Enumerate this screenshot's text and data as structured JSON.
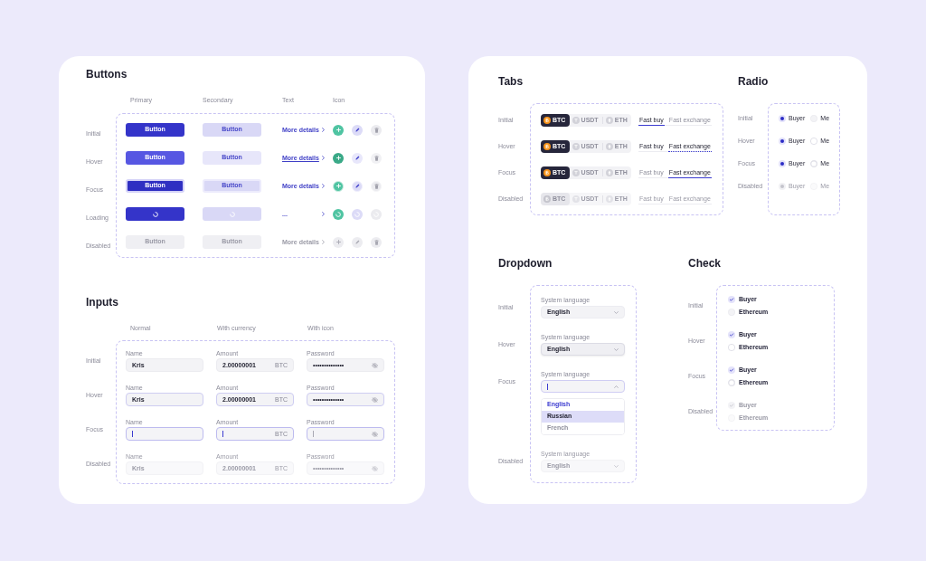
{
  "buttons": {
    "title": "Buttons",
    "columns": [
      "Primary",
      "Secondary",
      "Text",
      "Icon"
    ],
    "rows": [
      {
        "state": "Initial",
        "kind": "initial",
        "primary": "Button",
        "secondary": "Button",
        "link": "More details"
      },
      {
        "state": "Hover",
        "kind": "hover",
        "primary": "Button",
        "secondary": "Button",
        "link": "More details"
      },
      {
        "state": "Focus",
        "kind": "focus",
        "primary": "Button",
        "secondary": "Button",
        "link": "More details"
      },
      {
        "state": "Loading",
        "kind": "loading",
        "link": "..."
      },
      {
        "state": "Disabled",
        "kind": "disabled",
        "primary": "Button",
        "secondary": "Button",
        "link": "More details"
      }
    ]
  },
  "inputs": {
    "title": "Inputs",
    "columns": [
      "Normal",
      "With currency",
      "With icon"
    ],
    "rows": [
      {
        "state": "Initial",
        "kind": "initial",
        "fields": [
          {
            "kind": "text",
            "label": "Name",
            "value": "Kris"
          },
          {
            "kind": "currency",
            "label": "Amount",
            "value": "2.00000001",
            "currency": "BTC"
          },
          {
            "kind": "password",
            "label": "Password",
            "value": "••••••••••••••"
          }
        ]
      },
      {
        "state": "Hover",
        "kind": "hover",
        "fields": [
          {
            "kind": "text",
            "label": "Name",
            "value": "Kris"
          },
          {
            "kind": "currency",
            "label": "Amount",
            "value": "2.00000001",
            "currency": "BTC"
          },
          {
            "kind": "password",
            "label": "Password",
            "value": "••••••••••••••"
          }
        ]
      },
      {
        "state": "Focus",
        "kind": "focus",
        "fields": [
          {
            "kind": "text",
            "label": "Name"
          },
          {
            "kind": "currency",
            "label": "Amount",
            "currency": "BTC"
          },
          {
            "kind": "password",
            "label": "Password"
          }
        ]
      },
      {
        "state": "Disabled",
        "kind": "disabled",
        "fields": [
          {
            "kind": "text",
            "label": "Name",
            "value": "Kris"
          },
          {
            "kind": "currency",
            "label": "Amount",
            "value": "2.00000001",
            "currency": "BTC"
          },
          {
            "kind": "password",
            "label": "Password",
            "value": "••••••••••••••"
          }
        ]
      }
    ]
  },
  "tabs": {
    "title": "Tabs",
    "rows": [
      {
        "state": "Initial",
        "kind": "initial",
        "coins": [
          {
            "kind": "bitcoin",
            "label": "BTC",
            "selected": true
          },
          {
            "kind": "tether",
            "label": "USDT",
            "selected": false
          },
          {
            "kind": "ether",
            "label": "ETH",
            "selected": false
          }
        ],
        "tabs": [
          {
            "label": "Fast buy",
            "selected": true
          },
          {
            "label": "Fast exchange",
            "selected": false
          }
        ]
      },
      {
        "state": "Hover",
        "kind": "hover",
        "coins": [
          {
            "kind": "bitcoin",
            "label": "BTC",
            "selected": true
          },
          {
            "kind": "tether",
            "label": "USDT",
            "selected": false
          },
          {
            "kind": "ether",
            "label": "ETH",
            "selected": false
          }
        ],
        "tabs": [
          {
            "label": "Fast buy",
            "selected": false
          },
          {
            "label": "Fast exchange",
            "selected": true
          }
        ]
      },
      {
        "state": "Focus",
        "kind": "focus",
        "coins": [
          {
            "kind": "bitcoin",
            "label": "BTC",
            "selected": true
          },
          {
            "kind": "tether",
            "label": "USDT",
            "selected": false
          },
          {
            "kind": "ether",
            "label": "ETH",
            "selected": false
          }
        ],
        "tabs": [
          {
            "label": "Fast buy",
            "selected": false
          },
          {
            "label": "Fast exchange",
            "selected": true
          }
        ]
      },
      {
        "state": "Disabled",
        "kind": "disabled",
        "coins": [
          {
            "kind": "bitcoin",
            "label": "BTC",
            "selected": true
          },
          {
            "kind": "tether",
            "label": "USDT",
            "selected": false
          },
          {
            "kind": "ether",
            "label": "ETH",
            "selected": false
          }
        ],
        "tabs": [
          {
            "label": "Fast buy",
            "selected": false
          },
          {
            "label": "Fast exchange",
            "selected": false
          }
        ]
      }
    ]
  },
  "radio": {
    "title": "Radio",
    "rows": [
      {
        "state": "Initial",
        "kind": "initial",
        "options": [
          {
            "label": "Buyer",
            "selected": true
          },
          {
            "label": "Me",
            "selected": false
          }
        ]
      },
      {
        "state": "Hover",
        "kind": "hover",
        "options": [
          {
            "label": "Buyer",
            "selected": true
          },
          {
            "label": "Me",
            "selected": false
          }
        ]
      },
      {
        "state": "Focus",
        "kind": "focus",
        "options": [
          {
            "label": "Buyer",
            "selected": true
          },
          {
            "label": "Me",
            "selected": false
          }
        ]
      },
      {
        "state": "Disabled",
        "kind": "disabled",
        "options": [
          {
            "label": "Buyer",
            "selected": true
          },
          {
            "label": "Me",
            "selected": false
          }
        ]
      }
    ]
  },
  "dropdown": {
    "title": "Dropdown",
    "rows": [
      {
        "state": "Initial",
        "kind": "initial",
        "label": "System language",
        "value": "English",
        "expanded": false
      },
      {
        "state": "Hover",
        "kind": "hover",
        "label": "System language",
        "value": "English",
        "expanded": false
      },
      {
        "state": "Focus",
        "kind": "focus",
        "label": "System language",
        "expanded": true,
        "options": [
          {
            "label": "English",
            "selected": true,
            "hovered": false
          },
          {
            "label": "Russian",
            "selected": false,
            "hovered": true
          },
          {
            "label": "French",
            "selected": false,
            "hovered": false
          }
        ]
      },
      {
        "state": "Disabled",
        "kind": "disabled",
        "label": "System language",
        "value": "English",
        "expanded": false
      }
    ]
  },
  "check": {
    "title": "Check",
    "rows": [
      {
        "state": "Initial",
        "kind": "initial",
        "options": [
          {
            "label": "Buyer",
            "checked": true
          },
          {
            "label": "Ethereum",
            "checked": false
          }
        ]
      },
      {
        "state": "Hover",
        "kind": "hover",
        "options": [
          {
            "label": "Buyer",
            "checked": true
          },
          {
            "label": "Ethereum",
            "checked": false
          }
        ]
      },
      {
        "state": "Focus",
        "kind": "focus",
        "options": [
          {
            "label": "Buyer",
            "checked": true
          },
          {
            "label": "Ethereum",
            "checked": false
          }
        ]
      },
      {
        "state": "Disabled",
        "kind": "disabled",
        "options": [
          {
            "label": "Buyer",
            "checked": true
          },
          {
            "label": "Ethereum",
            "checked": false
          }
        ]
      }
    ]
  }
}
